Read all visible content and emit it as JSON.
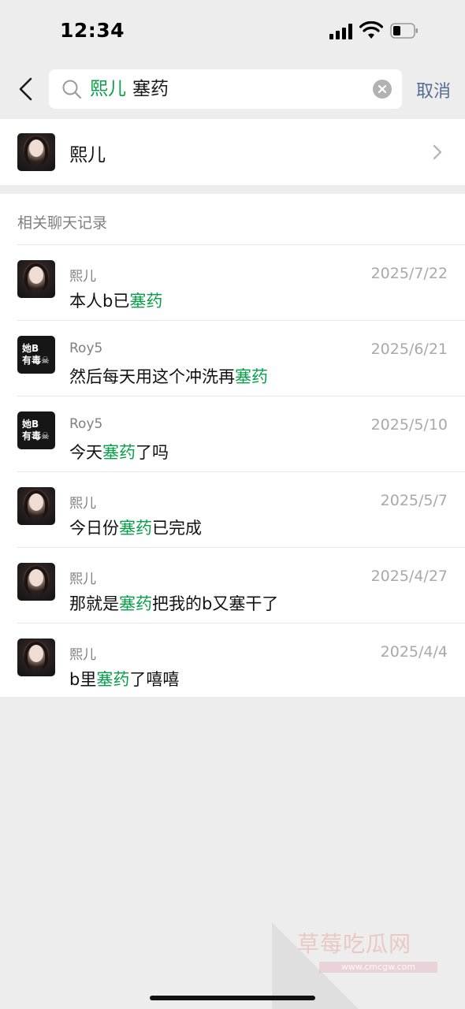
{
  "status_bar": {
    "time": "12:34"
  },
  "search": {
    "contact_token": "熙儿",
    "query_term": "塞药",
    "cancel_label": "取消"
  },
  "contact_result": {
    "name": "熙儿"
  },
  "records_section": {
    "title": "相关聊天记录",
    "items": [
      {
        "sender": "熙儿",
        "date": "2025/7/22",
        "pre": "本人b已",
        "hl": "塞药",
        "post": "",
        "avatar": "photo"
      },
      {
        "sender": "Roy5",
        "date": "2025/6/21",
        "pre": "然后每天用这个冲洗再",
        "hl": "塞药",
        "post": "",
        "avatar": "text"
      },
      {
        "sender": "Roy5",
        "date": "2025/5/10",
        "pre": "今天",
        "hl": "塞药",
        "post": "了吗",
        "avatar": "text"
      },
      {
        "sender": "熙儿",
        "date": "2025/5/7",
        "pre": "今日份",
        "hl": "塞药",
        "post": "已完成",
        "avatar": "photo"
      },
      {
        "sender": "熙儿",
        "date": "2025/4/27",
        "pre": "那就是",
        "hl": "塞药",
        "post": "把我的b又塞干了",
        "avatar": "photo"
      },
      {
        "sender": "熙儿",
        "date": "2025/4/4",
        "pre": "b里",
        "hl": "塞药",
        "post": "了嘻嘻",
        "avatar": "photo"
      }
    ]
  },
  "roy_avatar": {
    "line1": "她B",
    "line2": "有毒☠"
  },
  "watermark": {
    "title": "草莓吃瓜网",
    "url": "www.cmcgw.com"
  },
  "colors": {
    "highlight": "#07a048",
    "link": "#576b95",
    "background": "#ededed"
  }
}
